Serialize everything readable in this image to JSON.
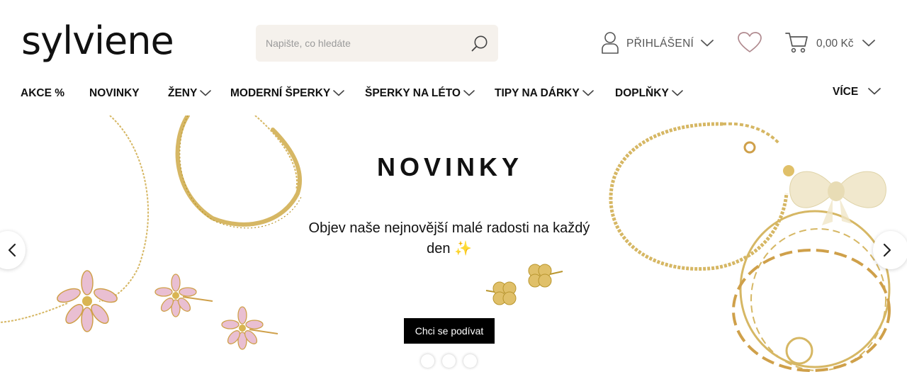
{
  "brand": {
    "logo_text": "sylviene"
  },
  "search": {
    "placeholder": "Napište, co hledáte"
  },
  "account": {
    "login_label": "PŘIHLÁŠENÍ"
  },
  "cart": {
    "total": "0,00 Kč"
  },
  "nav": {
    "items": [
      {
        "label": "AKCE %"
      },
      {
        "label": "NOVINKY"
      },
      {
        "label": "ŽENY"
      },
      {
        "label": "MODERNÍ ŠPERKY"
      },
      {
        "label": "ŠPERKY NA LÉTO"
      },
      {
        "label": "TIPY NA DÁRKY"
      },
      {
        "label": "DOPLŇKY"
      },
      {
        "label": "VÍCE"
      }
    ]
  },
  "hero": {
    "title": "NOVINKY",
    "subtitle": "Objev naše nejnovější malé radosti na každý den ✨",
    "cta": "Chci se podívat",
    "slide_count": 3
  },
  "icons": {
    "search": "search-icon",
    "user": "user-icon",
    "wishlist": "heart-icon",
    "cart": "cart-icon",
    "prev": "chevron-left-icon",
    "next": "chevron-right-icon",
    "dropdown": "chevron-down-icon"
  },
  "colors": {
    "search_bg": "#f5f1ec",
    "cta_bg": "#000000",
    "gold": "#d6b764",
    "pink": "#e9bfd2"
  }
}
